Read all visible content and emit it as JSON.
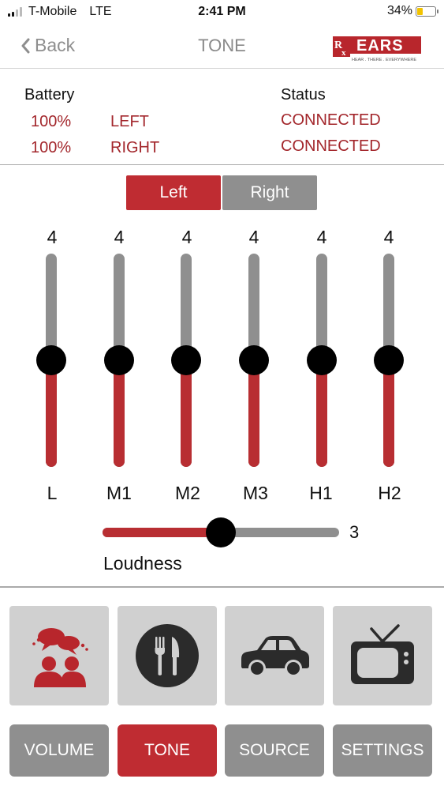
{
  "status_bar": {
    "carrier": "T-Mobile",
    "network": "LTE",
    "time": "2:41 PM",
    "battery_percent": "34%",
    "battery_level": 0.34
  },
  "nav": {
    "back_label": "Back",
    "title": "TONE",
    "logo_text": "EARS",
    "logo_prefix": "Rx",
    "logo_tagline": "HEAR. THERE. EVERYWHERE"
  },
  "info": {
    "battery_header": "Battery",
    "status_header": "Status",
    "rows": [
      {
        "battery": "100%",
        "side": "LEFT",
        "status": "CONNECTED"
      },
      {
        "battery": "100%",
        "side": "RIGHT",
        "status": "CONNECTED"
      }
    ]
  },
  "side_toggle": {
    "left_label": "Left",
    "right_label": "Right",
    "selected": "Left"
  },
  "equalizer": {
    "max_value": 8,
    "bands": [
      {
        "label": "L",
        "value": "4"
      },
      {
        "label": "M1",
        "value": "4"
      },
      {
        "label": "M2",
        "value": "4"
      },
      {
        "label": "M3",
        "value": "4"
      },
      {
        "label": "H1",
        "value": "4"
      },
      {
        "label": "H2",
        "value": "4"
      }
    ]
  },
  "loudness": {
    "label": "Loudness",
    "value": "3",
    "level": 0.5
  },
  "presets": [
    {
      "name": "conversation-preset",
      "icon": "conversation-icon",
      "selected": true
    },
    {
      "name": "restaurant-preset",
      "icon": "fork-knife-icon",
      "selected": false
    },
    {
      "name": "car-preset",
      "icon": "car-icon",
      "selected": false
    },
    {
      "name": "tv-preset",
      "icon": "tv-icon",
      "selected": false
    }
  ],
  "tabs": [
    {
      "label": "VOLUME",
      "active": false
    },
    {
      "label": "TONE",
      "active": true
    },
    {
      "label": "SOURCE",
      "active": false
    },
    {
      "label": "SETTINGS",
      "active": false
    }
  ],
  "colors": {
    "accent_red": "#bf2c32",
    "text_red": "#a3272c",
    "inactive_gray": "#8f8f8f",
    "tile_gray": "#d0d0d0"
  }
}
